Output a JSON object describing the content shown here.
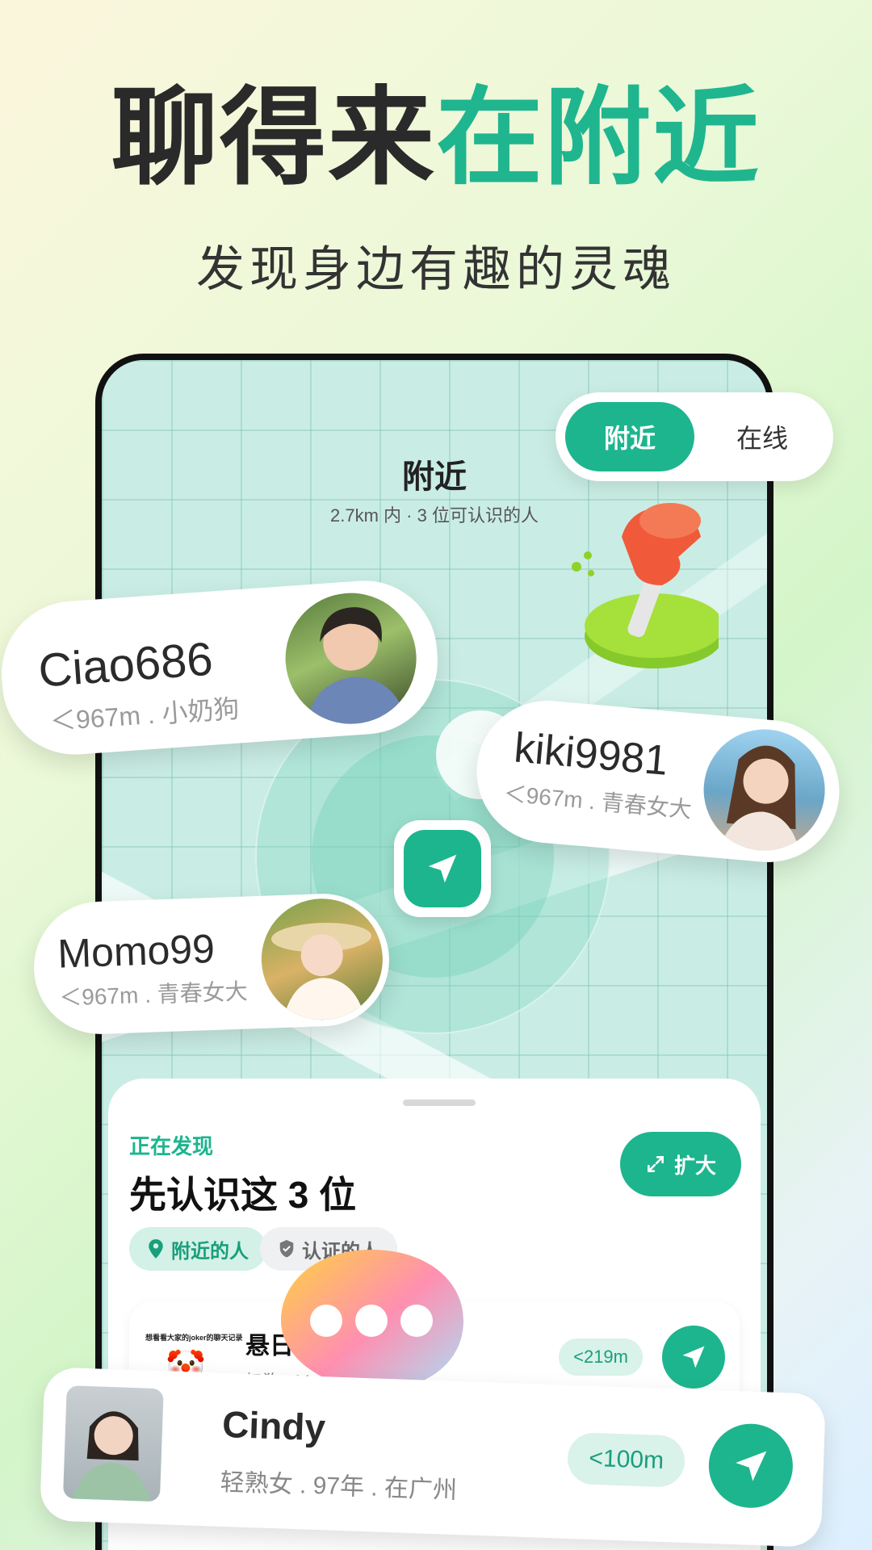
{
  "hero": {
    "title_dark": "聊得来",
    "title_green": "在附近",
    "subtitle": "发现身边有趣的灵魂"
  },
  "toggle": {
    "active": "附近",
    "inactive": "在线"
  },
  "map": {
    "title": "附近",
    "subtitle": "2.7km 内 · 3 位可认识的人"
  },
  "profiles": [
    {
      "name": "Ciao686",
      "meta": "＜967m . 小奶狗"
    },
    {
      "name": "kiki9981",
      "meta": "＜967m . 青春女大"
    },
    {
      "name": "Momo99",
      "meta": "＜967m . 青春女大"
    }
  ],
  "sheet": {
    "label": "正在发现",
    "title": "先认识这 3 位",
    "expand": "扩大",
    "chips": [
      "附近的人",
      "认证的人"
    ],
    "row": {
      "avatar_text": "想看看大家的joker的聊天记录",
      "name": "悬日",
      "sub": "奶狗 · V",
      "distance": "<219m"
    }
  },
  "featured": {
    "name": "Cindy",
    "meta": "轻熟女 . 97年 . 在广州",
    "distance": "<100m"
  },
  "colors": {
    "accent": "#1db58e",
    "dark": "#2a2a2a",
    "pin": "#f05a3a"
  }
}
